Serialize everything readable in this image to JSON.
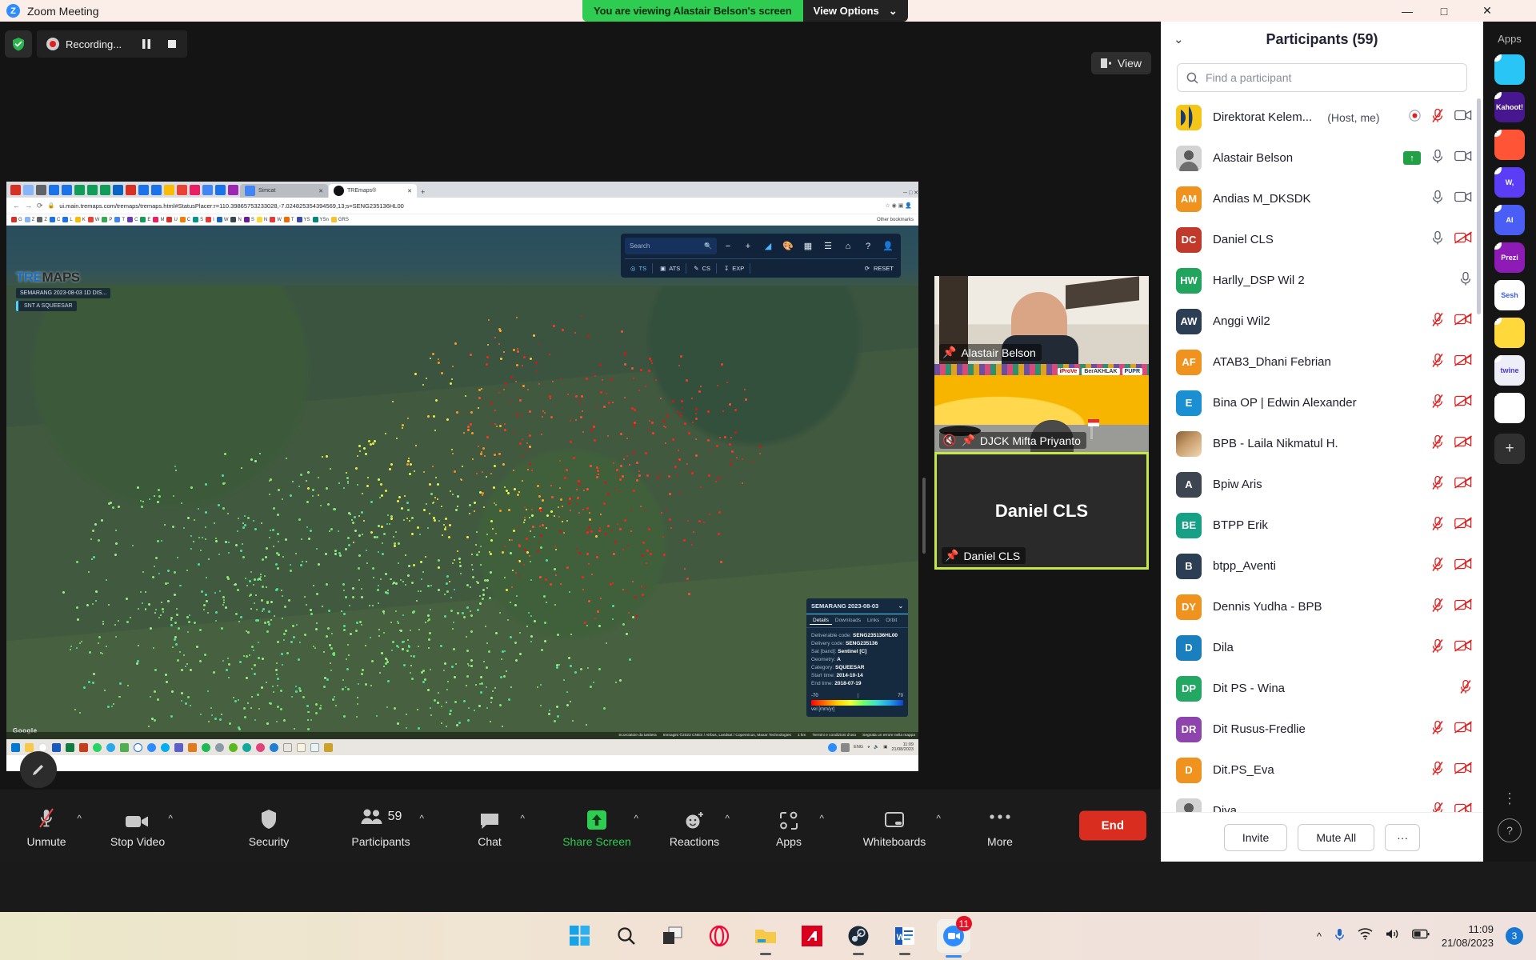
{
  "titlebar": {
    "app_title": "Zoom Meeting",
    "zoom_logo_letter": "Z",
    "share_banner": "You are viewing Alastair Belson's screen",
    "view_options_label": "View Options",
    "minimize": "—",
    "maximize": "□",
    "close": "✕"
  },
  "stage": {
    "recording_label": "Recording...",
    "view_button_label": "View"
  },
  "browser": {
    "tabs": [
      {
        "title": "Simcat",
        "active": false
      },
      {
        "title": "TREmaps®",
        "active": true
      }
    ],
    "new_tab_label": "+",
    "url": "ui.main.tremaps.com/tremaps/tremaps.html#StatusPlacer:r=110.39865753233028,-7.024825354394569,13;s=SENG235136HL00",
    "other_bookmarks_label": "Other bookmarks",
    "bookmark_labels": [
      "G",
      "Z",
      "Z",
      "C",
      "L",
      "K",
      "W",
      "P",
      "T",
      "C",
      "E",
      "M",
      "U",
      "C",
      "S",
      "I",
      "W",
      "N",
      "S",
      "N",
      "W",
      "T",
      "YS",
      "YSn",
      "GRS"
    ]
  },
  "map": {
    "logo_part1": "TRE",
    "logo_part2": "MAPS",
    "dataset_label": "SEMARANG 2023-08-03 1D DIS...",
    "dataset_sub": "SNT A   SQUEESAR",
    "search_placeholder": "Search",
    "toolbar_icons": [
      "search-icon",
      "minus-icon",
      "plus-icon",
      "measure-icon",
      "palette-icon",
      "grid-icon",
      "layers-icon",
      "home-icon",
      "help-icon",
      "account-icon"
    ],
    "tools": [
      {
        "label": "TS",
        "active": true
      },
      {
        "label": "ATS",
        "active": false
      },
      {
        "label": "CS",
        "active": false
      },
      {
        "label": "EXP",
        "active": false
      }
    ],
    "reset_label": "RESET",
    "google_attribution": "Google",
    "credits": [
      "Scorciatoie da tastiera",
      "Immagini ©2023 CNES / Airbus, Landsat / Copernicus, Maxar Technologies",
      "1 km",
      "Termini e condizioni d'uso",
      "Segnala un errore nella mappa"
    ]
  },
  "details_panel": {
    "title": "SEMARANG 2023-08-03",
    "tabs": [
      "Details",
      "Downloads",
      "Links",
      "Orbit"
    ],
    "active_tab": "Details",
    "fields": [
      {
        "key": "Deliverable code:",
        "value": "SENG235136HL00"
      },
      {
        "key": "Delivery code:",
        "value": "SENG235136"
      },
      {
        "key": "Sat [band]:",
        "value": "Sentinel [C]"
      },
      {
        "key": "Geometry:",
        "value": "A"
      },
      {
        "key": "Category:",
        "value": "SQUEESAR"
      },
      {
        "key": "Start time:",
        "value": "2014-10-14"
      },
      {
        "key": "End time:",
        "value": "2018-07-19"
      }
    ],
    "scale_min": "-70",
    "scale_max": "70",
    "scale_unit": "vel [mm/yr]"
  },
  "shared_taskbar": {
    "clock_time": "11:09",
    "clock_date": "21/08/2023",
    "language": "ENG"
  },
  "thumbnails": [
    {
      "name": "Alastair Belson",
      "pinned": true,
      "muted": false,
      "video_off": false
    },
    {
      "name": "DJCK Mifta Priyanto",
      "pinned": true,
      "muted": true,
      "video_off": false
    },
    {
      "name": "Daniel CLS",
      "pinned": true,
      "muted": false,
      "video_off": true,
      "speaking": true,
      "placeholder_name": "Daniel CLS"
    }
  ],
  "toolbar": {
    "buttons": [
      {
        "label": "Unmute",
        "icon": "mic-muted-icon",
        "caret": true,
        "highlight": false
      },
      {
        "label": "Stop Video",
        "icon": "video-icon",
        "caret": true,
        "highlight": false
      },
      {
        "label": "Security",
        "icon": "shield-icon",
        "caret": false,
        "highlight": false
      },
      {
        "label": "Participants",
        "icon": "participants-icon",
        "caret": true,
        "highlight": false,
        "badge": "59"
      },
      {
        "label": "Chat",
        "icon": "chat-icon",
        "caret": true,
        "highlight": false
      },
      {
        "label": "Share Screen",
        "icon": "share-screen-icon",
        "caret": true,
        "highlight": true
      },
      {
        "label": "Reactions",
        "icon": "reactions-icon",
        "caret": true,
        "highlight": false
      },
      {
        "label": "Apps",
        "icon": "apps-icon",
        "caret": true,
        "highlight": false
      },
      {
        "label": "Whiteboards",
        "icon": "whiteboard-icon",
        "caret": true,
        "highlight": false
      },
      {
        "label": "More",
        "icon": "more-dots-icon",
        "caret": false,
        "highlight": false
      }
    ],
    "end_label": "End"
  },
  "participants_panel": {
    "title": "Participants (59)",
    "search_placeholder": "Find a participant",
    "invite_label": "Invite",
    "mute_all_label": "Mute All",
    "more_label": "···",
    "rows": [
      {
        "name": "Direktorat Kelem...",
        "suffix": "(Host, me)",
        "initials": "",
        "color": "#f5c518",
        "photo": "logo",
        "rec": true,
        "mic": "muted",
        "cam": "on"
      },
      {
        "name": "Alastair Belson",
        "suffix": "",
        "initials": "",
        "color": "#c8c8c8",
        "photo": "person",
        "share": true,
        "mic": "on",
        "cam": "on"
      },
      {
        "name": "Andias M_DKSDK",
        "suffix": "",
        "initials": "AM",
        "color": "#f0921e",
        "mic": "on",
        "cam": "on"
      },
      {
        "name": "Daniel CLS",
        "suffix": "",
        "initials": "DC",
        "color": "#c0392b",
        "mic": "on",
        "cam": "off"
      },
      {
        "name": "Harlly_DSP Wil 2",
        "suffix": "",
        "initials": "HW",
        "color": "#21a45c",
        "mic": "on",
        "cam": "none"
      },
      {
        "name": "Anggi Wil2",
        "suffix": "",
        "initials": "AW",
        "color": "#2c3e54",
        "mic": "muted",
        "cam": "off"
      },
      {
        "name": "ATAB3_Dhani Febrian",
        "suffix": "",
        "initials": "AF",
        "color": "#f0921e",
        "mic": "muted",
        "cam": "off"
      },
      {
        "name": "Bina OP | Edwin Alexander",
        "suffix": "",
        "initials": "E",
        "color": "#1a8fd1",
        "mic": "muted",
        "cam": "off"
      },
      {
        "name": "BPB - Laila Nikmatul H.",
        "suffix": "",
        "initials": "",
        "color": "#6b4a2a",
        "photo": "image",
        "mic": "muted",
        "cam": "off"
      },
      {
        "name": "Bpiw Aris",
        "suffix": "",
        "initials": "A",
        "color": "#3d4550",
        "mic": "muted",
        "cam": "off"
      },
      {
        "name": "BTPP Erik",
        "suffix": "",
        "initials": "BE",
        "color": "#16a085",
        "mic": "muted",
        "cam": "off"
      },
      {
        "name": "btpp_Aventi",
        "suffix": "",
        "initials": "B",
        "color": "#2c3e54",
        "mic": "muted",
        "cam": "off"
      },
      {
        "name": "Dennis Yudha - BPB",
        "suffix": "",
        "initials": "DY",
        "color": "#f0921e",
        "mic": "muted",
        "cam": "off"
      },
      {
        "name": "Dila",
        "suffix": "",
        "initials": "D",
        "color": "#1a7fbf",
        "mic": "muted",
        "cam": "off"
      },
      {
        "name": "Dit PS - Wina",
        "suffix": "",
        "initials": "DP",
        "color": "#22a862",
        "mic": "muted",
        "cam": "none"
      },
      {
        "name": "Dit Rusus-Fredlie",
        "suffix": "",
        "initials": "DR",
        "color": "#8e44ad",
        "mic": "muted",
        "cam": "off"
      },
      {
        "name": "Dit.PS_Eva",
        "suffix": "",
        "initials": "D",
        "color": "#f0921e",
        "mic": "muted",
        "cam": "off"
      },
      {
        "name": "Diya",
        "suffix": "",
        "initials": "",
        "color": "#444",
        "photo": "person",
        "mic": "muted",
        "cam": "off"
      }
    ]
  },
  "apps_rail": {
    "title": "Apps",
    "items": [
      {
        "name": "asana",
        "label": "",
        "bg": "#29c5f6",
        "fg": "#ffffff"
      },
      {
        "name": "kahoot",
        "label": "Kahoot!",
        "bg": "#46178f",
        "fg": "#ffffff"
      },
      {
        "name": "canva",
        "label": "",
        "bg": "#ff5436",
        "fg": "#ffffff"
      },
      {
        "name": "wordly",
        "label": "W,",
        "bg": "#5b3df5",
        "fg": "#ffffff"
      },
      {
        "name": "ai-app",
        "label": "AI",
        "bg": "#4a5df5",
        "fg": "#ffffff"
      },
      {
        "name": "prezi",
        "label": "Prezi",
        "bg": "#8e1bb5",
        "fg": "#ffffff"
      },
      {
        "name": "sesh",
        "label": "Sesh",
        "bg": "#ffffff",
        "fg": "#3b5bf5"
      },
      {
        "name": "emoji",
        "label": "",
        "bg": "#ffd93b",
        "fg": "#333333"
      },
      {
        "name": "twine",
        "label": "twine",
        "bg": "#eeeef8",
        "fg": "#4b3bd0"
      },
      {
        "name": "grid",
        "label": "",
        "bg": "#ffffff",
        "fg": "#333333"
      }
    ],
    "add_label": "+",
    "more_label": "⋮",
    "help_label": "?"
  },
  "windows_taskbar": {
    "icons": [
      "start-icon",
      "search-icon",
      "task-view-icon",
      "opera-icon",
      "file-explorer-icon",
      "amd-icon",
      "steam-icon",
      "word-icon",
      "zoom-icon"
    ],
    "zoom_badge": "11",
    "clock_time": "11:09",
    "clock_date": "21/08/2023",
    "tray_badge": "3",
    "tray_icons": [
      "chevron-up-icon",
      "mic-icon",
      "wifi-icon",
      "volume-icon",
      "battery-icon"
    ]
  }
}
